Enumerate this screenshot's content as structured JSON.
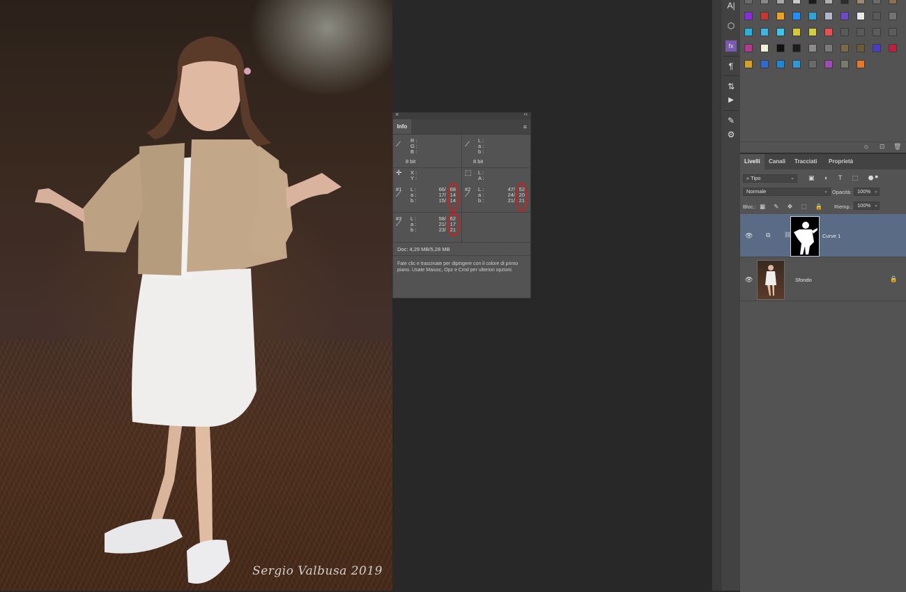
{
  "photo": {
    "signature": "Sergio Valbusa 2019"
  },
  "info_panel": {
    "close": "×",
    "collapse": "‹‹",
    "tab": "Info",
    "menu": "≡",
    "rgb_labels": "R :\nG :\nB :",
    "rgb_bits": "8 bit",
    "lab_labels": "L :\na :\nb :",
    "lab_bits": "8 bit",
    "xy_labels": "X :\nY :",
    "la_labels": "L :\nA :",
    "sample1": {
      "tag": "#1",
      "labels": "L :\na :\nb :",
      "before": "66/\n17/\n15/",
      "after": "68\n14\n14"
    },
    "sample2": {
      "tag": "#2",
      "labels": "L :\na :\nb :",
      "before": "47/\n24/\n21/",
      "after": "52\n20\n21"
    },
    "sample3": {
      "tag": "#3",
      "labels": "L :\na :\nb :",
      "before": "58/\n21/\n23/",
      "after": "62\n17\n21"
    },
    "doc": "Doc: 4,29 MB/5,28 MB",
    "help": "Fate clic e trascinate per dipingere con il colore di primo piano. Usate Maiusc, Opz e Cmd per ulteriori opzioni."
  },
  "dock_icons": [
    {
      "icon": "A|",
      "name": "character-icon"
    },
    {
      "icon": "⬡",
      "name": "3d-icon"
    },
    {
      "icon": "fx",
      "name": "styles-icon"
    },
    {
      "icon": "¶",
      "name": "paragraph-icon"
    },
    {
      "icon": "⇅",
      "name": "history-icon"
    },
    {
      "icon": "▶",
      "name": "actions-icon"
    },
    {
      "icon": "✎",
      "name": "brush-icon"
    },
    {
      "icon": "⚙",
      "name": "adjustments-icon"
    }
  ],
  "swatch_colors": [
    [
      "#6b6b6b",
      "#888888",
      "#a8a8a8",
      "#c8c8c8",
      "#1c1c1c",
      "#b0b0b0",
      "#2d2d2d",
      "#9c8b6e",
      "#6c6c6c",
      "#8a7250"
    ],
    [
      "#8a2be2",
      "#c7382c",
      "#f0a020",
      "#1e90ff",
      "#2fa4d8",
      "#b0b8c8",
      "#6e4ac8",
      "#e8e8e8",
      "#5a5a5a",
      "#737373"
    ],
    [
      "#25b0e0",
      "#3bb5e6",
      "#35c8e8",
      "#d9c836",
      "#d0d03a",
      "#e85050",
      "#5a5a5a",
      "#5a5a5a",
      "#5c5c5c",
      "#5c5c5c"
    ],
    [
      "#b23a8c",
      "#f1f1d8",
      "#121212",
      "#1c1c1c",
      "#8c8c8c",
      "#7a7a7a",
      "#7c6a46",
      "#6b5a3a",
      "#4a3cc8",
      "#c02040"
    ],
    [
      "#d8a020",
      "#2a6cd0",
      "#1e88d8",
      "#2e9ad8",
      "#6a6a6a",
      "#a04ab8",
      "#7a7a6a",
      "#e87828"
    ]
  ],
  "swatch_footer": {
    "a": "⦸",
    "b": "⊡",
    "c": "🗑"
  },
  "layers_panel": {
    "tabs": [
      "Livelli",
      "Canali",
      "Tracciati",
      "Proprietà"
    ],
    "filter": "⌕ Tipo",
    "filter_icons": "▣ ◐ T ⬚ ⬣",
    "blend_mode": "Normale",
    "opacity_label": "Opacità:",
    "opacity_value": "100%",
    "lock_label": "Bloc.:",
    "lock_icons": "▦ ✎ ✥ ⬚ 🔒",
    "fill_label": "Riemp.:",
    "fill_value": "100%",
    "layers": [
      {
        "name": "Curve 1",
        "eye": "👁",
        "selected": true
      },
      {
        "name": "Sfondo",
        "eye": "👁",
        "selected": false,
        "lock": "🔒"
      }
    ]
  }
}
